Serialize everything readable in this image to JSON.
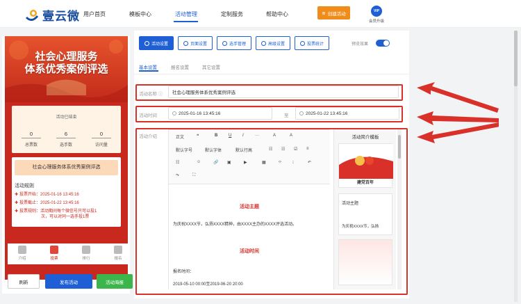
{
  "brand": {
    "name": "壹云微"
  },
  "nav": [
    {
      "label": "用户首页"
    },
    {
      "label": "模板中心"
    },
    {
      "label": "活动管理"
    },
    {
      "label": "定制服务"
    },
    {
      "label": "帮助中心"
    }
  ],
  "header": {
    "create_label": "创建活动",
    "vip_badge": "VIP",
    "vip_label": "会员升级"
  },
  "preview": {
    "banner_title_line1": "社会心理服务",
    "banner_title_line2": "体系优秀案例评选",
    "status": "活动已结束",
    "stats": [
      {
        "value": "0",
        "label": "总票数"
      },
      {
        "value": "6",
        "label": "选手数"
      },
      {
        "value": "0",
        "label": "访问量"
      }
    ],
    "activity_name": "社会心理服务体系优秀案例评选",
    "rules_title": "活动规则",
    "rules": [
      "投票开始：2025-01-16 13:45:16",
      "投票截止：2025-01-22 13:45:16",
      "投票规则：活动期间每个微信号只可以投1",
      "次，可以对同一选手投1票"
    ],
    "tabs": [
      {
        "label": "介绍"
      },
      {
        "label": "投票"
      },
      {
        "label": "排行"
      },
      {
        "label": "报名"
      }
    ]
  },
  "actions": {
    "refresh": "刷新",
    "publish": "发布活动",
    "poster": "活动海报"
  },
  "toolbar": {
    "buttons": [
      {
        "label": "活动设置"
      },
      {
        "label": "页面设置"
      },
      {
        "label": "选手管理"
      },
      {
        "label": "高级设置"
      },
      {
        "label": "投票统计"
      }
    ],
    "preview_label": "预览效果",
    "preview_on": true
  },
  "subtabs": [
    {
      "label": "基本设置"
    },
    {
      "label": "报名设置"
    },
    {
      "label": "其它设置"
    }
  ],
  "form": {
    "name_label": "活动名称",
    "name_value": "社会心理服务体系优秀案例评选",
    "time_label": "活动时间",
    "start_time": "2025-01-16 13:45:16",
    "to_label": "至",
    "end_time": "2025-01-22 13:45:16",
    "intro_label": "活动介绍"
  },
  "editor": {
    "toolbar_row1": [
      "正文",
      "❝",
      "B",
      "U",
      "I",
      "···",
      "A",
      "A"
    ],
    "toolbar_row2": [
      "默认字号",
      "默认字体",
      "默认行高",
      "☷",
      "☷",
      "☑",
      "≡"
    ],
    "toolbar_row3": [
      "☷",
      "☺",
      "🔗",
      "▣",
      "▶",
      "▦",
      "‹›",
      "⁝",
      "↶"
    ],
    "toolbar_row4": [
      "↷",
      "⛶"
    ],
    "heading1": "活动主题",
    "para1": "为庆祝XXXX节，弘扬XXXX精神，由XXXX主办的XXXX评选活动。",
    "heading2": "活动时间",
    "para2": "报名时间：",
    "para3": "2019-05-10 00:00至2019-06-20 20:00"
  },
  "templates": {
    "title": "活动简介模板",
    "t1_caption": "建党百年",
    "t2_caption": "活动主题",
    "t2_text": "为庆祝XXXX节，弘扬"
  },
  "colors": {
    "primary": "#1f5fd6",
    "accent": "#f08c1a",
    "red": "#c8281e",
    "green": "#3cb54a"
  }
}
